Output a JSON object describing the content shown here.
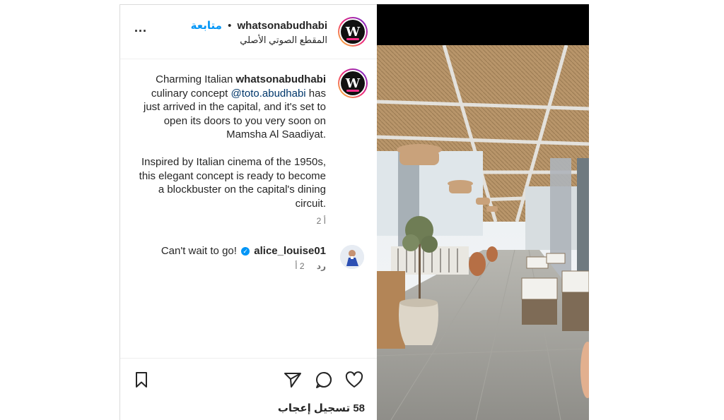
{
  "header": {
    "username": "whatsonabudhabi",
    "separator": "•",
    "follow_label": "متابعة",
    "audio_label": "المقطع الصوتي الأصلي",
    "avatar_letter": "W",
    "more_label": "..."
  },
  "caption": {
    "username": "whatsonabudhabi",
    "part1": "Charming Italian ",
    "part2": " culinary concept ",
    "mention": "@toto.abudhabi",
    "part3": " has just arrived in the capital, and it's set to open its doors to you very soon on Mamsha Al Saadiyat.",
    "paragraph2": "Inspired by Italian cinema of the 1950s, this elegant concept is ready to become a blockbuster on the capital's dining circuit.",
    "time": "2 أ"
  },
  "comment": {
    "text": "Can't wait to go!",
    "username": "alice_louise01",
    "verified_glyph": "✓",
    "time": "2 أ",
    "reply_label": "رد"
  },
  "actions": {
    "like_icon": "heart-icon",
    "comment_icon": "comment-icon",
    "share_icon": "send-icon",
    "save_icon": "bookmark-icon",
    "likes_text": "58 تسجيل إعجاب"
  },
  "colors": {
    "accent": "#0095f6",
    "mention": "#00376b",
    "muted": "#737373",
    "text": "#262626"
  }
}
